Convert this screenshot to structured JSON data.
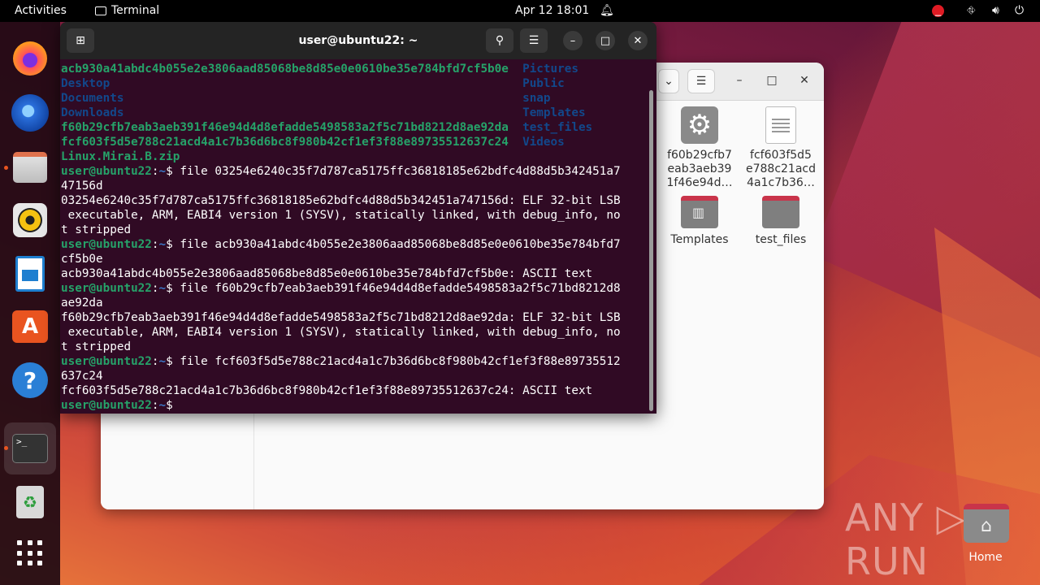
{
  "topbar": {
    "activities": "Activities",
    "app_name": "Terminal",
    "clock": "Apr 12  18:01",
    "bell_icon": "bell-icon",
    "status_icons": [
      "stop-icon",
      "network-icon",
      "volume-icon",
      "power-icon"
    ]
  },
  "dock": {
    "items": [
      "firefox",
      "thunderbird",
      "files",
      "rhythmbox",
      "libreoffice-writer",
      "app-center",
      "help",
      "terminal",
      "trash",
      "show-apps"
    ]
  },
  "terminal": {
    "title": "user@ubuntu22: ~",
    "lines": [
      [
        {
          "t": "acb930a41abdc4b055e2e3806aad85068be8d85e0e0610be35e784bfd7cf5b0e  ",
          "c": "green"
        },
        {
          "t": "Pictures",
          "c": "blue"
        }
      ],
      [
        {
          "t": "Desktop                                                           ",
          "c": "blue"
        },
        {
          "t": "Public",
          "c": "blue"
        }
      ],
      [
        {
          "t": "Documents                                                         ",
          "c": "blue"
        },
        {
          "t": "snap",
          "c": "blue"
        }
      ],
      [
        {
          "t": "Downloads                                                         ",
          "c": "blue"
        },
        {
          "t": "Templates",
          "c": "blue"
        }
      ],
      [
        {
          "t": "f60b29cfb7eab3aeb391f46e94d4d8efadde5498583a2f5c71bd8212d8ae92da  ",
          "c": "green"
        },
        {
          "t": "test_files",
          "c": "blue"
        }
      ],
      [
        {
          "t": "fcf603f5d5e788c21acd4a1c7b36d6bc8f980b42cf1ef3f88e89735512637c24  ",
          "c": "green"
        },
        {
          "t": "Videos",
          "c": "blue"
        }
      ],
      [
        {
          "t": "Linux.Mirai.B.zip",
          "c": "green"
        }
      ],
      [
        {
          "t": "user@ubuntu22",
          "c": "prompt"
        },
        {
          "t": ":",
          "c": "plain"
        },
        {
          "t": "~",
          "c": "path"
        },
        {
          "t": "$ file 03254e6240c35f7d787ca5175ffc36818185e62bdfc4d88d5b342451a7",
          "c": "plain"
        }
      ],
      [
        {
          "t": "47156d",
          "c": "plain"
        }
      ],
      [
        {
          "t": "03254e6240c35f7d787ca5175ffc36818185e62bdfc4d88d5b342451a747156d: ELF 32-bit LSB",
          "c": "plain"
        }
      ],
      [
        {
          "t": " executable, ARM, EABI4 version 1 (SYSV), statically linked, with debug_info, no",
          "c": "plain"
        }
      ],
      [
        {
          "t": "t stripped",
          "c": "plain"
        }
      ],
      [
        {
          "t": "user@ubuntu22",
          "c": "prompt"
        },
        {
          "t": ":",
          "c": "plain"
        },
        {
          "t": "~",
          "c": "path"
        },
        {
          "t": "$ file acb930a41abdc4b055e2e3806aad85068be8d85e0e0610be35e784bfd7",
          "c": "plain"
        }
      ],
      [
        {
          "t": "cf5b0e",
          "c": "plain"
        }
      ],
      [
        {
          "t": "acb930a41abdc4b055e2e3806aad85068be8d85e0e0610be35e784bfd7cf5b0e: ASCII text",
          "c": "plain"
        }
      ],
      [
        {
          "t": "user@ubuntu22",
          "c": "prompt"
        },
        {
          "t": ":",
          "c": "plain"
        },
        {
          "t": "~",
          "c": "path"
        },
        {
          "t": "$ file f60b29cfb7eab3aeb391f46e94d4d8efadde5498583a2f5c71bd8212d8",
          "c": "plain"
        }
      ],
      [
        {
          "t": "ae92da",
          "c": "plain"
        }
      ],
      [
        {
          "t": "f60b29cfb7eab3aeb391f46e94d4d8efadde5498583a2f5c71bd8212d8ae92da: ELF 32-bit LSB",
          "c": "plain"
        }
      ],
      [
        {
          "t": " executable, ARM, EABI4 version 1 (SYSV), statically linked, with debug_info, no",
          "c": "plain"
        }
      ],
      [
        {
          "t": "t stripped",
          "c": "plain"
        }
      ],
      [
        {
          "t": "user@ubuntu22",
          "c": "prompt"
        },
        {
          "t": ":",
          "c": "plain"
        },
        {
          "t": "~",
          "c": "path"
        },
        {
          "t": "$ file fcf603f5d5e788c21acd4a1c7b36d6bc8f980b42cf1ef3f88e89735512",
          "c": "plain"
        }
      ],
      [
        {
          "t": "637c24",
          "c": "plain"
        }
      ],
      [
        {
          "t": "fcf603f5d5e788c21acd4a1c7b36d6bc8f980b42cf1ef3f88e89735512637c24: ASCII text",
          "c": "plain"
        }
      ],
      [
        {
          "t": "user@ubuntu22",
          "c": "prompt"
        },
        {
          "t": ":",
          "c": "plain"
        },
        {
          "t": "~",
          "c": "path"
        },
        {
          "t": "$ ",
          "c": "plain"
        }
      ]
    ]
  },
  "file_manager": {
    "files": [
      {
        "name": "f60b29cfb7eab3aeb391f46e94d…",
        "label_lines": [
          "f60b29cfb7",
          "eab3aeb39",
          "1f46e94d…"
        ],
        "icon": "gear-icon"
      },
      {
        "name": "fcf603f5d5e788c21acd4a1c7b36…",
        "label_lines": [
          "fcf603f5d5",
          "e788c21acd",
          "4a1c7b36…"
        ],
        "icon": "text-document-icon"
      },
      {
        "name": "Templates",
        "label_lines": [
          "Templates"
        ],
        "icon": "templates-folder-icon"
      },
      {
        "name": "test_files",
        "label_lines": [
          "test_files"
        ],
        "icon": "folder-icon"
      }
    ]
  },
  "desktop": {
    "home_label": "Home",
    "watermark": "ANY ▷ RUN"
  }
}
